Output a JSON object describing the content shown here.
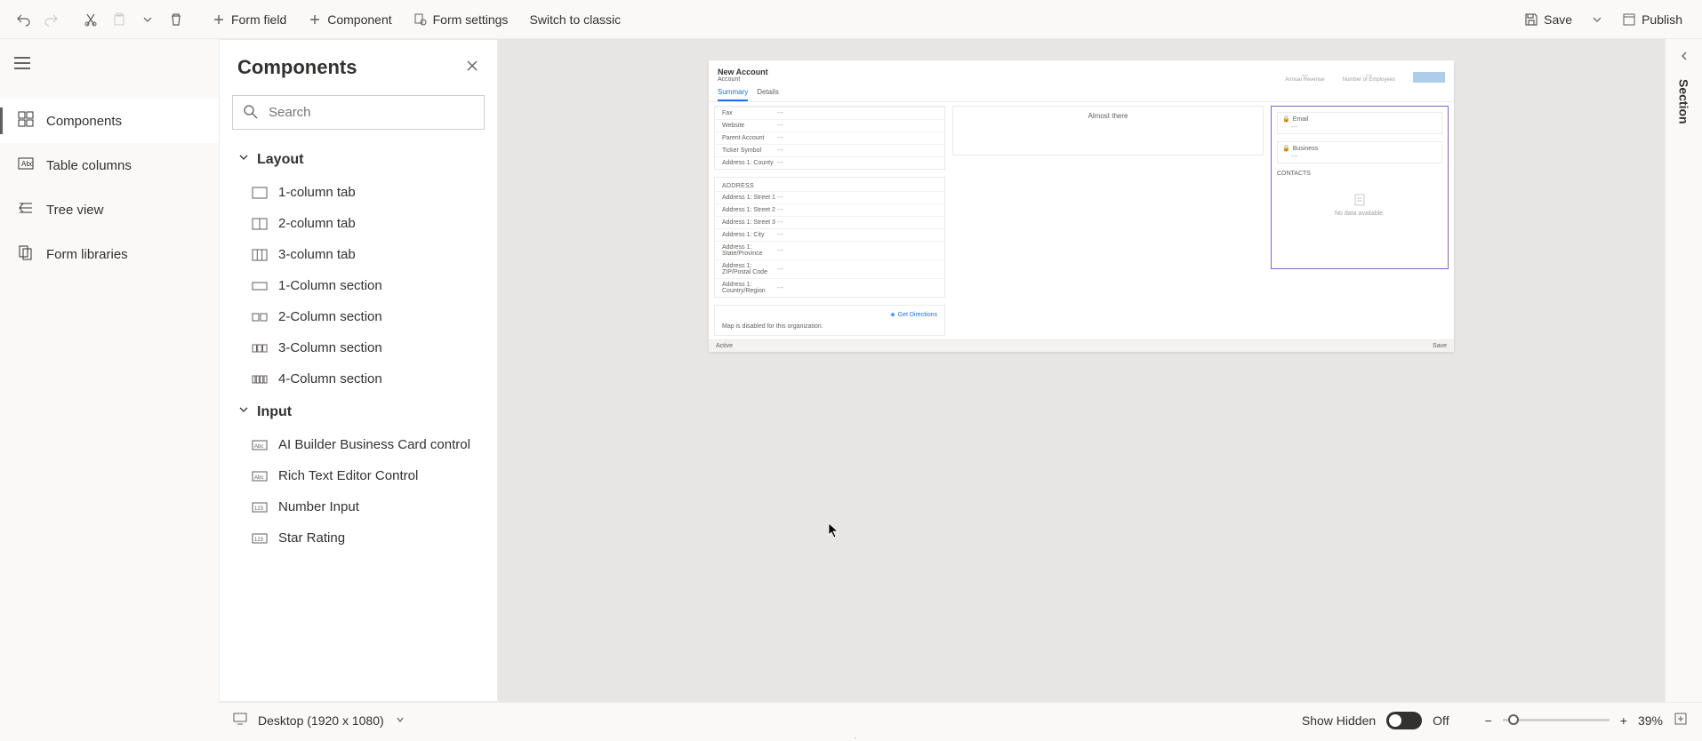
{
  "toolbar": {
    "form_field": "Form field",
    "component": "Component",
    "form_settings": "Form settings",
    "switch_classic": "Switch to classic",
    "save": "Save",
    "publish": "Publish"
  },
  "leftrail": {
    "items": [
      {
        "label": "Components"
      },
      {
        "label": "Table columns"
      },
      {
        "label": "Tree view"
      },
      {
        "label": "Form libraries"
      }
    ]
  },
  "panel": {
    "title": "Components",
    "search_placeholder": "Search",
    "groups": {
      "layout": {
        "title": "Layout",
        "items": [
          "1-column tab",
          "2-column tab",
          "3-column tab",
          "1-Column section",
          "2-Column section",
          "3-Column section",
          "4-Column section"
        ]
      },
      "input": {
        "title": "Input",
        "items": [
          "AI Builder Business Card control",
          "Rich Text Editor Control",
          "Number Input",
          "Star Rating"
        ]
      }
    }
  },
  "canvas": {
    "form_title": "New Account",
    "entity": "Account",
    "header_fields": [
      "Annual Revenue",
      "Number of Employees"
    ],
    "tabs": {
      "summary": "Summary",
      "details": "Details"
    },
    "timeline_placeholder": "Almost there",
    "left_fields_top": [
      {
        "label": "Fax",
        "value": "---"
      },
      {
        "label": "Website",
        "value": "---"
      },
      {
        "label": "Parent Account",
        "value": "---"
      },
      {
        "label": "Ticker Symbol",
        "value": "---"
      },
      {
        "label": "Address 1: County",
        "value": "---"
      }
    ],
    "address_section_title": "ADDRESS",
    "address_fields": [
      {
        "label": "Address 1: Street 1",
        "value": "---"
      },
      {
        "label": "Address 1: Street 2",
        "value": "---"
      },
      {
        "label": "Address 1: Street 3",
        "value": "---"
      },
      {
        "label": "Address 1: City",
        "value": "---"
      },
      {
        "label": "Address 1: State/Province",
        "value": "---"
      },
      {
        "label": "Address 1: ZIP/Postal Code",
        "value": "---"
      },
      {
        "label": "Address 1: Country/Region",
        "value": "---"
      }
    ],
    "map_link": "Get Directions",
    "map_disabled": "Map is disabled for this organization.",
    "right_fields": [
      {
        "label": "Email",
        "value": "---"
      },
      {
        "label": "Business",
        "value": "---"
      }
    ],
    "contacts_title": "CONTACTS",
    "no_data": "No data available.",
    "footer_status": "Active",
    "footer_save": "Save"
  },
  "rightpane": {
    "label": "Section"
  },
  "bottombar": {
    "viewport": "Desktop (1920 x 1080)",
    "show_hidden": "Show Hidden",
    "toggle_state": "Off",
    "zoom": "39%"
  }
}
